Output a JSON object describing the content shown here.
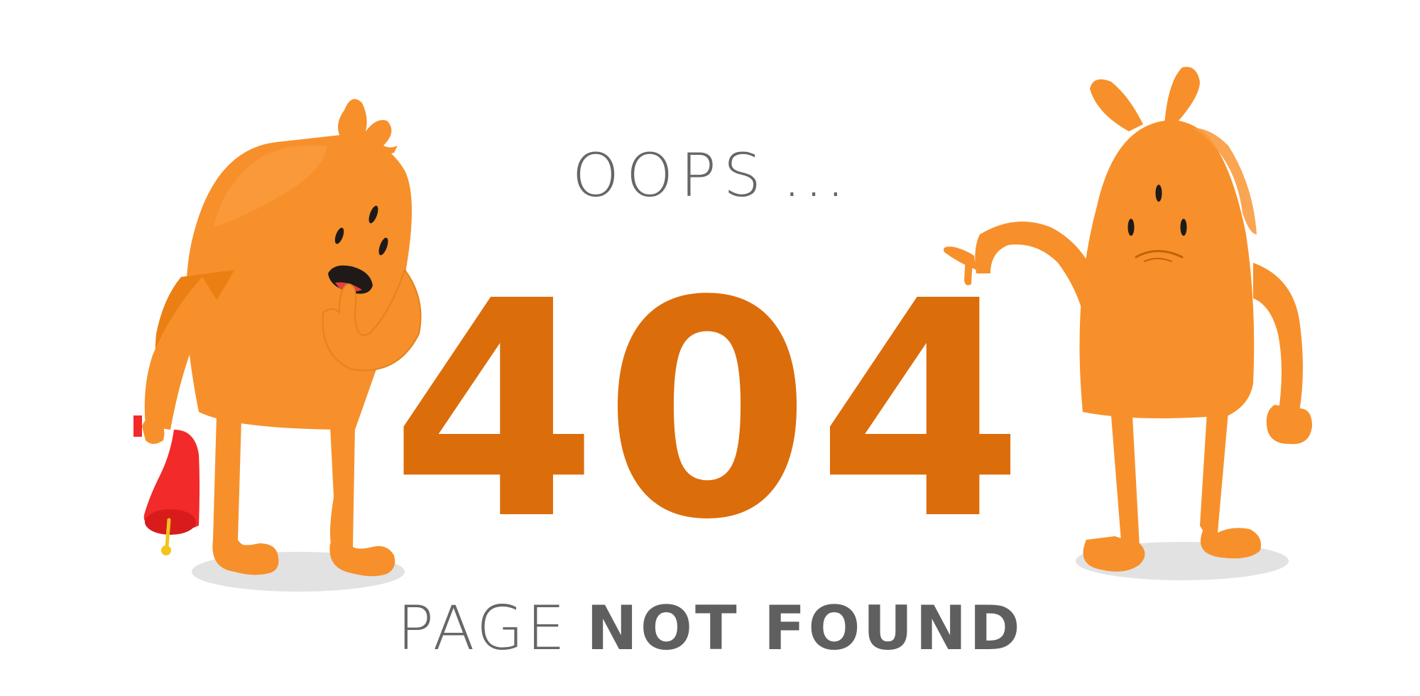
{
  "headline": {
    "oops": "OOPS",
    "ellipsis": "..."
  },
  "error": {
    "code": "404"
  },
  "message": {
    "page": "PAGE",
    "not_found": "NOT FOUND"
  },
  "colors": {
    "code_orange": "#dc6d0b",
    "monster_orange": "#f7902a",
    "monster_shade": "#ec7f14",
    "text_gray": "#666666",
    "shadow_gray": "#e2e2e2",
    "bell_red": "#f22a2a"
  }
}
